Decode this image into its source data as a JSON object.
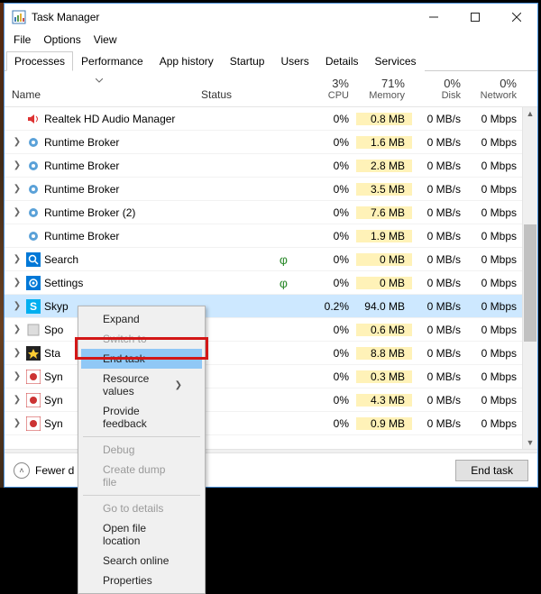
{
  "window": {
    "title": "Task Manager"
  },
  "menu": {
    "file": "File",
    "options": "Options",
    "view": "View"
  },
  "tabs": [
    "Processes",
    "Performance",
    "App history",
    "Startup",
    "Users",
    "Details",
    "Services"
  ],
  "columns": {
    "name": "Name",
    "status": "Status",
    "cpu": {
      "pct": "3%",
      "label": "CPU"
    },
    "mem": {
      "pct": "71%",
      "label": "Memory"
    },
    "disk": {
      "pct": "0%",
      "label": "Disk"
    },
    "net": {
      "pct": "0%",
      "label": "Network"
    }
  },
  "rows": [
    {
      "icon": "speaker",
      "name": "Realtek HD Audio Manager",
      "expand": false,
      "leaf": false,
      "cpu": "0%",
      "mem": "0.8 MB",
      "disk": "0 MB/s",
      "net": "0 Mbps"
    },
    {
      "icon": "gear",
      "name": "Runtime Broker",
      "expand": true,
      "leaf": false,
      "cpu": "0%",
      "mem": "1.6 MB",
      "disk": "0 MB/s",
      "net": "0 Mbps"
    },
    {
      "icon": "gear",
      "name": "Runtime Broker",
      "expand": true,
      "leaf": false,
      "cpu": "0%",
      "mem": "2.8 MB",
      "disk": "0 MB/s",
      "net": "0 Mbps"
    },
    {
      "icon": "gear",
      "name": "Runtime Broker",
      "expand": true,
      "leaf": false,
      "cpu": "0%",
      "mem": "3.5 MB",
      "disk": "0 MB/s",
      "net": "0 Mbps"
    },
    {
      "icon": "gear",
      "name": "Runtime Broker (2)",
      "expand": true,
      "leaf": false,
      "cpu": "0%",
      "mem": "7.6 MB",
      "disk": "0 MB/s",
      "net": "0 Mbps"
    },
    {
      "icon": "gear",
      "name": "Runtime Broker",
      "expand": false,
      "leaf": false,
      "cpu": "0%",
      "mem": "1.9 MB",
      "disk": "0 MB/s",
      "net": "0 Mbps"
    },
    {
      "icon": "search",
      "name": "Search",
      "expand": true,
      "leaf": true,
      "cpu": "0%",
      "mem": "0 MB",
      "disk": "0 MB/s",
      "net": "0 Mbps"
    },
    {
      "icon": "settings",
      "name": "Settings",
      "expand": true,
      "leaf": true,
      "cpu": "0%",
      "mem": "0 MB",
      "disk": "0 MB/s",
      "net": "0 Mbps"
    },
    {
      "icon": "skype",
      "name": "Skyp",
      "expand": true,
      "leaf": false,
      "selected": true,
      "cpu": "0.2%",
      "mem": "94.0 MB",
      "disk": "0 MB/s",
      "net": "0 Mbps"
    },
    {
      "icon": "blank",
      "name": "Spo",
      "expand": true,
      "leaf": false,
      "cpu": "0%",
      "mem": "0.6 MB",
      "disk": "0 MB/s",
      "net": "0 Mbps"
    },
    {
      "icon": "star",
      "name": "Sta",
      "expand": true,
      "leaf": false,
      "cpu": "0%",
      "mem": "8.8 MB",
      "disk": "0 MB/s",
      "net": "0 Mbps"
    },
    {
      "icon": "syn",
      "name": "Syn",
      "expand": true,
      "leaf": false,
      "cpu": "0%",
      "mem": "0.3 MB",
      "disk": "0 MB/s",
      "net": "0 Mbps"
    },
    {
      "icon": "syn",
      "name": "Syn",
      "expand": true,
      "leaf": false,
      "cpu": "0%",
      "mem": "4.3 MB",
      "disk": "0 MB/s",
      "net": "0 Mbps"
    },
    {
      "icon": "syn",
      "name": "Syn",
      "expand": true,
      "leaf": false,
      "cpu": "0%",
      "mem": "0.9 MB",
      "disk": "0 MB/s",
      "net": "0 Mbps"
    }
  ],
  "context_menu": {
    "items": [
      {
        "label": "Expand",
        "enabled": true
      },
      {
        "label": "Switch to",
        "enabled": false
      },
      {
        "label": "End task",
        "enabled": true,
        "highlight": true
      },
      {
        "label": "Resource values",
        "enabled": true,
        "submenu": true
      },
      {
        "label": "Provide feedback",
        "enabled": true
      },
      {
        "sep": true
      },
      {
        "label": "Debug",
        "enabled": false
      },
      {
        "label": "Create dump file",
        "enabled": false
      },
      {
        "sep": true
      },
      {
        "label": "Go to details",
        "enabled": false
      },
      {
        "label": "Open file location",
        "enabled": true
      },
      {
        "label": "Search online",
        "enabled": true
      },
      {
        "label": "Properties",
        "enabled": true
      }
    ]
  },
  "footer": {
    "fewer": "Fewer d",
    "end_task": "End task"
  }
}
